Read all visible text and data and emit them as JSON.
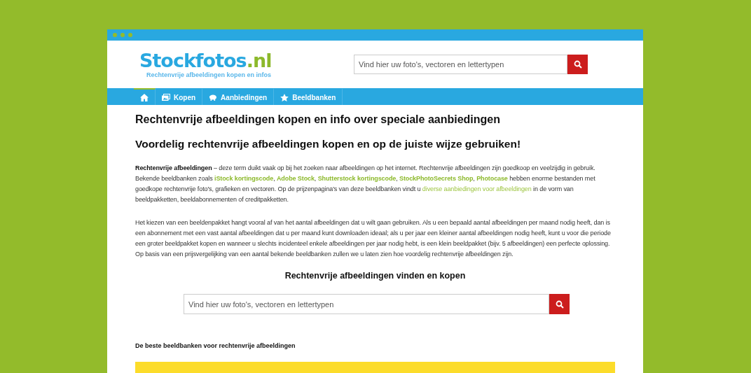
{
  "logo": {
    "name": "Stockfotos",
    "suffix": ".nl",
    "tagline": "Rechtenvrije afbeeldingen kopen en infos"
  },
  "header_search": {
    "placeholder": "Vind hier uw foto's, vectoren en lettertypen"
  },
  "nav": [
    {
      "kind": "home",
      "selected": true
    },
    {
      "kind": "images",
      "label": "Kopen",
      "selected": false
    },
    {
      "kind": "piggy",
      "label": "Aanbiedingen",
      "selected": false
    },
    {
      "kind": "star",
      "label": "Beeldbanken",
      "selected": false
    }
  ],
  "title": "Rechtenvrije afbeeldingen kopen en info over speciale aanbiedingen",
  "subtitle": "Voordelig rechtenvrije afbeeldingen kopen en op de juiste wijze gebruiken!",
  "intro": [
    {
      "kind": "bold",
      "text": "Rechtenvrije afbeeldingen"
    },
    {
      "kind": "plain",
      "text": " – deze term duikt vaak op bij het zoeken naar afbeeldingen op het internet. Rechtenvrije afbeeldingen zijn goedkoop en veelzijdig in gebruik. Bekende beeldbanken zoals "
    },
    {
      "kind": "link",
      "text": "iStock kortingscode"
    },
    {
      "kind": "plain",
      "text": ", "
    },
    {
      "kind": "link",
      "text": "Adobe Stock"
    },
    {
      "kind": "plain",
      "text": ", "
    },
    {
      "kind": "link",
      "text": "Shutterstock kortingscode"
    },
    {
      "kind": "plain",
      "text": ", "
    },
    {
      "kind": "link",
      "text": "StockPhotoSecrets Shop"
    },
    {
      "kind": "plain",
      "text": ", "
    },
    {
      "kind": "link",
      "text": "Photocase"
    },
    {
      "kind": "plain",
      "text": " hebben enorme bestanden met goedkope rechtenvrije foto's, grafieken en vectoren. Op de prijzenpagina's van deze beeldbanken vindt u "
    },
    {
      "kind": "light-link",
      "text": "diverse aanbiedingen voor afbeeldingen"
    },
    {
      "kind": "plain",
      "text": " in de vorm van beeldpakketten, beeldabonnementen of creditpakketten."
    }
  ],
  "paragraph": "Het kiezen van een beeldenpakket hangt vooral af van het aantal afbeeldingen dat u wilt gaan gebruiken. Als u een bepaald aantal afbeeldingen per maand nodig heeft, dan is een abonnement met een vast aantal afbeeldingen dat u per maand kunt downloaden ideaal; als u per jaar een kleiner aantal afbeeldingen nodig heeft, kunt u voor die periode een groter beeldpakket kopen en wanneer u slechts incidenteel enkele afbeeldingen per jaar nodig hebt, is een klein beeldpakket (bijv. 5 afbeeldingen) een perfecte oplossing. Op basis van een prijsvergelijking van een aantal bekende beeldbanken zullen we u laten zien hoe voordelig rechtenvrije afbeeldingen zijn.",
  "search_heading": "Rechtenvrije afbeeldingen vinden en kopen",
  "content_search": {
    "placeholder": "Vind hier uw foto's, vectoren en lettertypen"
  },
  "table_heading": "De beste beeldbanken voor rechtenvrije afbeeldingen"
}
